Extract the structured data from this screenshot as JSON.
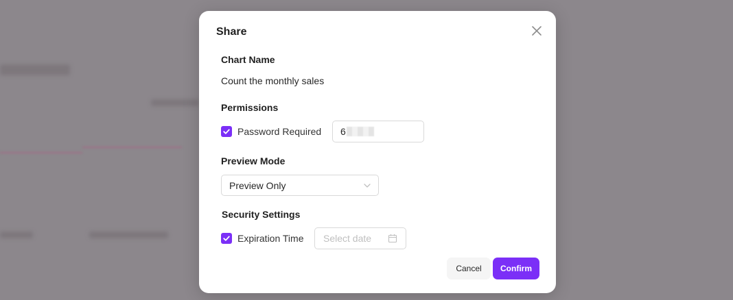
{
  "dialog": {
    "title": "Share",
    "chart_name_label": "Chart Name",
    "chart_name_value": "Count the monthly sales",
    "permissions_label": "Permissions",
    "password_required_label": "Password Required",
    "password_required_checked": true,
    "password_value": "6",
    "preview_mode_label": "Preview Mode",
    "preview_mode_selected": "Preview Only",
    "security_settings_label": "Security Settings",
    "expiration_time_label": "Expiration Time",
    "expiration_time_checked": true,
    "date_placeholder": "Select date",
    "cancel_label": "Cancel",
    "confirm_label": "Confirm"
  },
  "colors": {
    "accent": "#7b2ff7",
    "backdrop": "#8c878c"
  }
}
